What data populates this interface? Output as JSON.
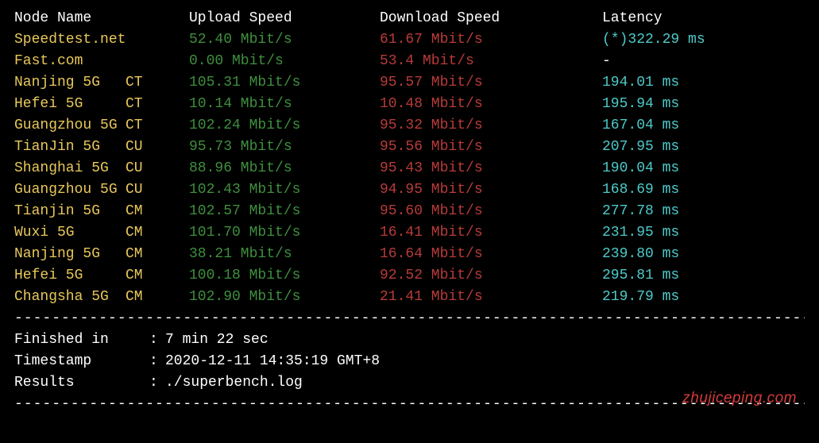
{
  "headers": {
    "node": "Node Name",
    "upload": "Upload Speed",
    "download": "Download Speed",
    "latency": "Latency"
  },
  "rows": [
    {
      "name": "Speedtest.net",
      "tag": "",
      "upload": "52.40 Mbit/s",
      "download": "61.67 Mbit/s",
      "latency": "(*)322.29 ms"
    },
    {
      "name": "Fast.com",
      "tag": "",
      "upload": "0.00 Mbit/s",
      "download": "53.4 Mbit/s",
      "latency": "-"
    },
    {
      "name": "Nanjing 5G",
      "tag": "CT",
      "upload": "105.31 Mbit/s",
      "download": "95.57 Mbit/s",
      "latency": "194.01 ms"
    },
    {
      "name": "Hefei 5G",
      "tag": "CT",
      "upload": "10.14 Mbit/s",
      "download": "10.48 Mbit/s",
      "latency": "195.94 ms"
    },
    {
      "name": "Guangzhou 5G",
      "tag": "CT",
      "upload": "102.24 Mbit/s",
      "download": "95.32 Mbit/s",
      "latency": "167.04 ms"
    },
    {
      "name": "TianJin 5G",
      "tag": "CU",
      "upload": "95.73 Mbit/s",
      "download": "95.56 Mbit/s",
      "latency": "207.95 ms"
    },
    {
      "name": "Shanghai 5G",
      "tag": "CU",
      "upload": "88.96 Mbit/s",
      "download": "95.43 Mbit/s",
      "latency": "190.04 ms"
    },
    {
      "name": "Guangzhou 5G",
      "tag": "CU",
      "upload": "102.43 Mbit/s",
      "download": "94.95 Mbit/s",
      "latency": "168.69 ms"
    },
    {
      "name": "Tianjin 5G",
      "tag": "CM",
      "upload": "102.57 Mbit/s",
      "download": "95.60 Mbit/s",
      "latency": "277.78 ms"
    },
    {
      "name": "Wuxi 5G",
      "tag": "CM",
      "upload": "101.70 Mbit/s",
      "download": "16.41 Mbit/s",
      "latency": "231.95 ms"
    },
    {
      "name": "Nanjing 5G",
      "tag": "CM",
      "upload": "38.21 Mbit/s",
      "download": "16.64 Mbit/s",
      "latency": "239.80 ms"
    },
    {
      "name": "Hefei 5G",
      "tag": "CM",
      "upload": "100.18 Mbit/s",
      "download": "92.52 Mbit/s",
      "latency": "295.81 ms"
    },
    {
      "name": "Changsha 5G",
      "tag": "CM",
      "upload": "102.90 Mbit/s",
      "download": "21.41 Mbit/s",
      "latency": "219.79 ms"
    }
  ],
  "divider": "----------------------------------------------------------------------------------------",
  "footer": {
    "finished_label": " Finished in",
    "finished_value": "7 min 22 sec",
    "timestamp_label": " Timestamp",
    "timestamp_value": "2020-12-11 14:35:19 GMT+8",
    "results_label": " Results",
    "results_value": "./superbench.log",
    "colon": ":"
  },
  "watermark": "zhujiceping.com"
}
